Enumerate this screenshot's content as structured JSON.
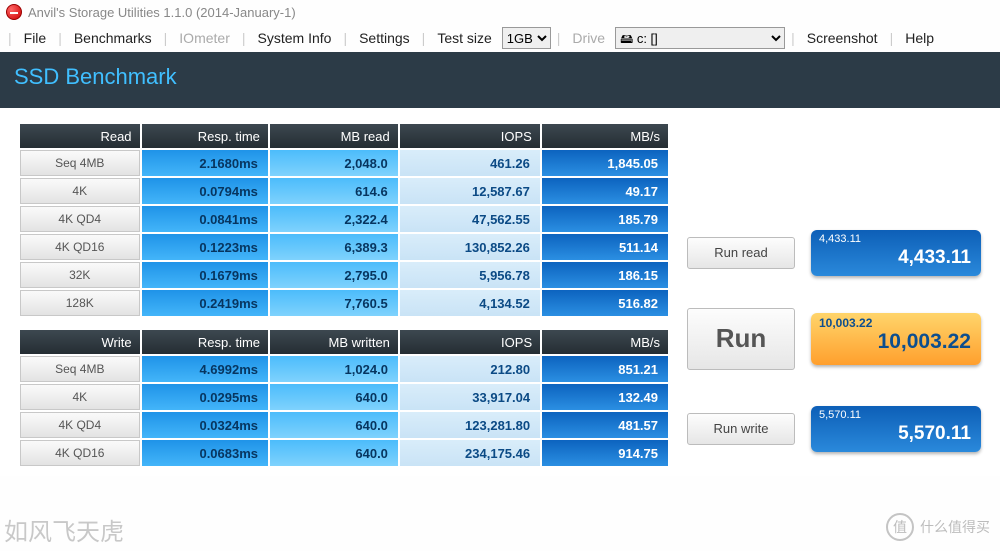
{
  "app": {
    "title": "Anvil's Storage Utilities 1.1.0 (2014-January-1)"
  },
  "toolbar": {
    "file": "File",
    "benchmarks": "Benchmarks",
    "iometer": "IOmeter",
    "system_info": "System Info",
    "settings": "Settings",
    "test_size_label": "Test size",
    "test_size_value": "1GB",
    "drive_label": "Drive",
    "drive_value": "🖴 c: []",
    "screenshot": "Screenshot",
    "help": "Help"
  },
  "header": {
    "title": "SSD Benchmark"
  },
  "read": {
    "headers": [
      "Read",
      "Resp. time",
      "MB read",
      "IOPS",
      "MB/s"
    ],
    "rows": [
      {
        "label": "Seq 4MB",
        "resp": "2.1680ms",
        "mb": "2,048.0",
        "iops": "461.26",
        "mbs": "1,845.05"
      },
      {
        "label": "4K",
        "resp": "0.0794ms",
        "mb": "614.6",
        "iops": "12,587.67",
        "mbs": "49.17"
      },
      {
        "label": "4K QD4",
        "resp": "0.0841ms",
        "mb": "2,322.4",
        "iops": "47,562.55",
        "mbs": "185.79"
      },
      {
        "label": "4K QD16",
        "resp": "0.1223ms",
        "mb": "6,389.3",
        "iops": "130,852.26",
        "mbs": "511.14"
      },
      {
        "label": "32K",
        "resp": "0.1679ms",
        "mb": "2,795.0",
        "iops": "5,956.78",
        "mbs": "186.15"
      },
      {
        "label": "128K",
        "resp": "0.2419ms",
        "mb": "7,760.5",
        "iops": "4,134.52",
        "mbs": "516.82"
      }
    ]
  },
  "write": {
    "headers": [
      "Write",
      "Resp. time",
      "MB written",
      "IOPS",
      "MB/s"
    ],
    "rows": [
      {
        "label": "Seq 4MB",
        "resp": "4.6992ms",
        "mb": "1,024.0",
        "iops": "212.80",
        "mbs": "851.21"
      },
      {
        "label": "4K",
        "resp": "0.0295ms",
        "mb": "640.0",
        "iops": "33,917.04",
        "mbs": "132.49"
      },
      {
        "label": "4K QD4",
        "resp": "0.0324ms",
        "mb": "640.0",
        "iops": "123,281.80",
        "mbs": "481.57"
      },
      {
        "label": "4K QD16",
        "resp": "0.0683ms",
        "mb": "640.0",
        "iops": "234,175.46",
        "mbs": "914.75"
      }
    ]
  },
  "buttons": {
    "run_read": "Run read",
    "run": "Run",
    "run_write": "Run write"
  },
  "scores": {
    "read_small": "4,433.11",
    "read_big": "4,433.11",
    "total_small": "10,003.22",
    "total_big": "10,003.22",
    "write_small": "5,570.11",
    "write_big": "5,570.11"
  },
  "watermark": {
    "left": "如风飞天虎",
    "right_char": "值",
    "right_text": "什么值得买"
  }
}
